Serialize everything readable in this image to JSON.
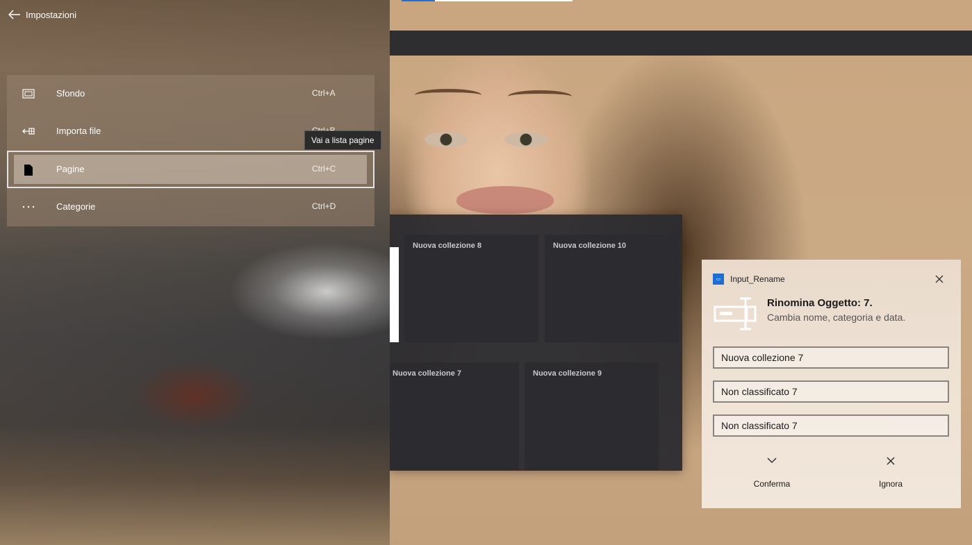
{
  "header": {
    "title": "Impostazioni"
  },
  "menu": {
    "items": [
      {
        "icon": "background-icon",
        "label": "Sfondo",
        "shortcut": "Ctrl+A"
      },
      {
        "icon": "import-file-icon",
        "label": "Importa file",
        "shortcut": "Ctrl+B"
      },
      {
        "icon": "page-icon",
        "label": "Pagine",
        "shortcut": "Ctrl+C",
        "selected": true
      },
      {
        "icon": "more-icon",
        "label": "Categorie",
        "shortcut": "Ctrl+D"
      }
    ]
  },
  "tooltip": {
    "text": "Vai a lista pagine"
  },
  "collections": {
    "tiles": [
      {
        "title": "Nuova collezione 8"
      },
      {
        "title": "Nuova collezione 10"
      },
      {
        "title": "Nuova collezione 7"
      },
      {
        "title": "Nuova collezione 9"
      }
    ]
  },
  "dialog": {
    "app_name": "Input_Rename",
    "title": "Rinomina Oggetto: 7.",
    "subtitle": "Cambia nome, categoria e data.",
    "fields": [
      {
        "value": "Nuova collezione 7"
      },
      {
        "value": "Non classificato 7"
      },
      {
        "value": "Non classificato 7"
      }
    ],
    "confirm_label": "Conferma",
    "ignore_label": "Ignora"
  },
  "colors": {
    "accent": "#1e6fd6",
    "panel_dark": "#2b2b30",
    "dialog_bg": "#f0e4d7"
  }
}
